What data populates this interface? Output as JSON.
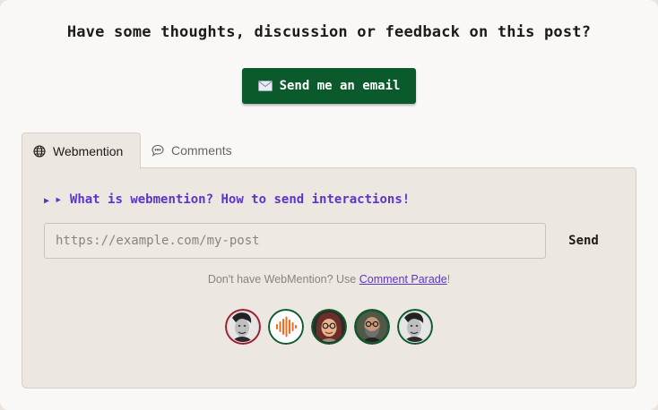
{
  "heading": "Have some thoughts, discussion or feedback on this post?",
  "email_button": {
    "icon": "envelope-icon",
    "label": "Send me an email"
  },
  "tabs": [
    {
      "label": "Webmention",
      "icon": "globe-icon",
      "active": true
    },
    {
      "label": "Comments",
      "icon": "speech-bubble-icon",
      "active": false
    }
  ],
  "webmention": {
    "summary": "▸ What is webmention? How to send interactions!",
    "input": {
      "placeholder": "https://example.com/my-post",
      "value": ""
    },
    "send_label": "Send",
    "footnote_prefix": "Don't have WebMention? Use ",
    "footnote_link": "Comment Parade",
    "footnote_suffix": "!"
  },
  "avatars": [
    {
      "name": "avatar-1",
      "ring": "#a01c2c"
    },
    {
      "name": "avatar-2",
      "ring": "#0a5a2c"
    },
    {
      "name": "avatar-3",
      "ring": "#0a5a2c"
    },
    {
      "name": "avatar-4",
      "ring": "#0a5a2c"
    },
    {
      "name": "avatar-5",
      "ring": "#0a5a2c"
    }
  ],
  "colors": {
    "accent_green": "#0a5a2c",
    "link_purple": "#5b35c9",
    "panel_bg": "#ede7e1"
  }
}
